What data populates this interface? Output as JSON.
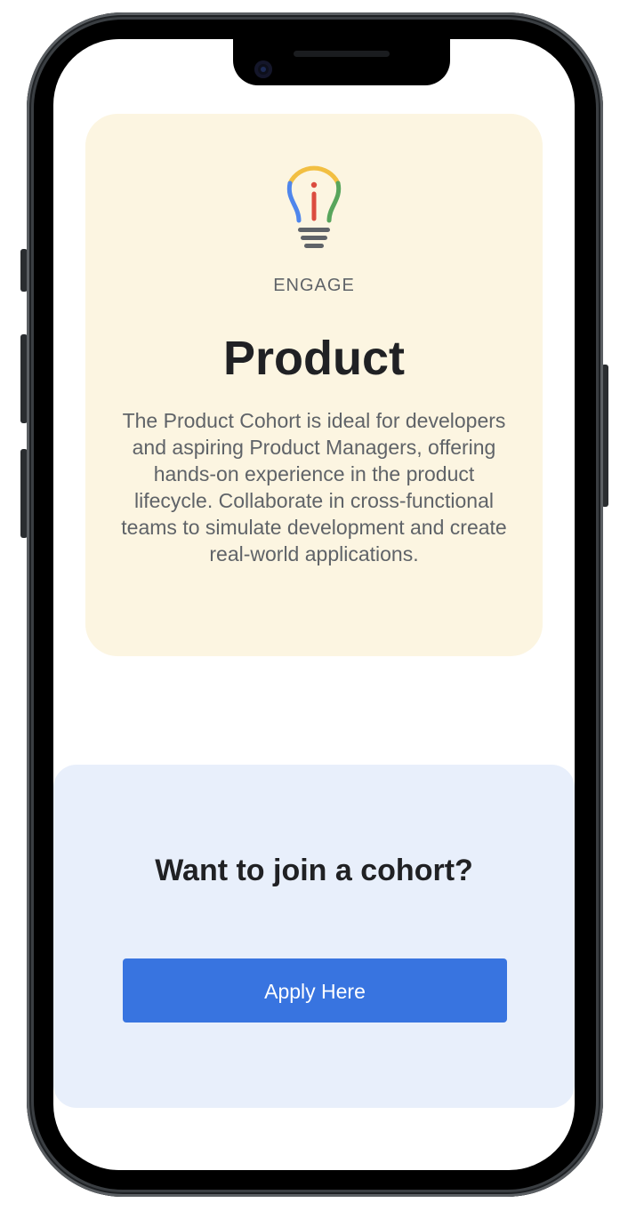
{
  "card": {
    "icon": "lightbulb-icon",
    "eyebrow": "ENGAGE",
    "title": "Product",
    "description": "The Product Cohort is ideal for developers and aspiring Product Managers, offering hands-on experience in the product lifecycle. Collaborate in cross-functional teams to simulate development and create real-world applications.",
    "background": "#fcf5e1"
  },
  "cta": {
    "heading": "Want to join a cohort?",
    "button_label": "Apply Here",
    "background": "#e8effb",
    "button_color": "#3874e0"
  },
  "icon_colors": {
    "yellow": "#f2bf42",
    "blue": "#4f86ec",
    "red": "#db4c3f",
    "green": "#58a55c",
    "gray": "#5f6368"
  }
}
